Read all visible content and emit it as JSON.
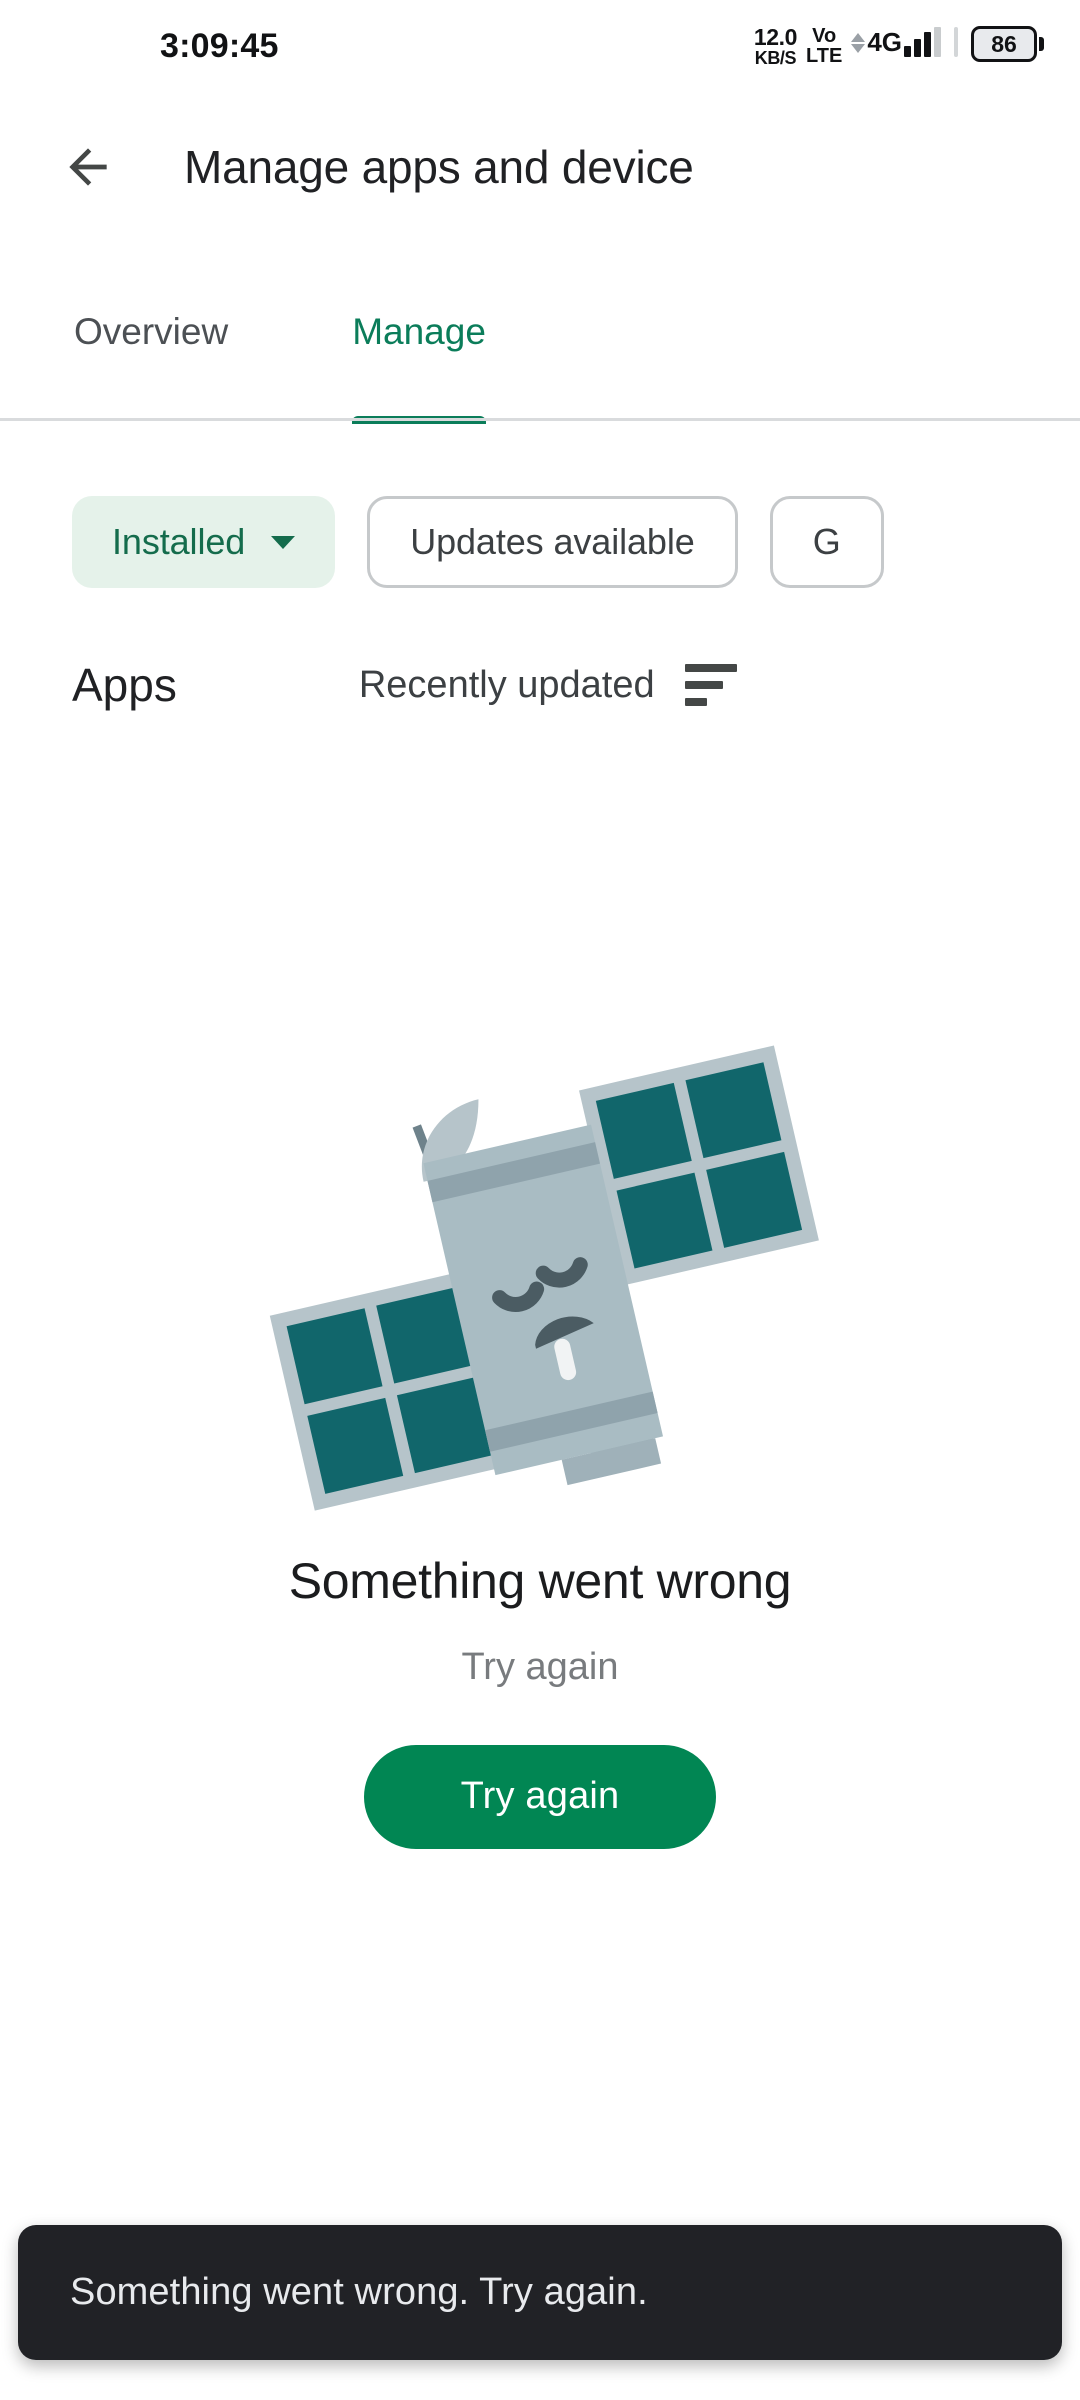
{
  "status_bar": {
    "clock": "3:09:45",
    "net_speed_value": "12.0",
    "net_speed_unit": "KB/S",
    "volte_line1": "Vo",
    "volte_line2": "LTE",
    "network_type": "4G",
    "battery_level": "86"
  },
  "app_bar": {
    "title": "Manage apps and device",
    "back_icon": "arrow-left-icon"
  },
  "tabs": [
    {
      "label": "Overview",
      "active": false
    },
    {
      "label": "Manage",
      "active": true
    }
  ],
  "chips": [
    {
      "label": "Installed",
      "selected": true,
      "has_caret": true
    },
    {
      "label": "Updates available",
      "selected": false,
      "has_caret": false
    },
    {
      "label": "G",
      "selected": false,
      "has_caret": false
    }
  ],
  "apps_section": {
    "heading": "Apps",
    "sort_label": "Recently updated",
    "sort_icon": "sort-lines-icon"
  },
  "error_state": {
    "illustration": "sad-satellite-illustration",
    "title": "Something went wrong",
    "subtitle": "Try again",
    "button_label": "Try again"
  },
  "snackbar": {
    "message": "Something went wrong. Try again."
  },
  "colors": {
    "brand_green": "#018653",
    "tab_green": "#0b7d5a",
    "chip_selected_bg": "#e5f2ea",
    "chip_selected_text": "#146c4c",
    "snackbar_bg": "#212226",
    "satellite_body": "#a9bcc3",
    "satellite_panel": "#11666b",
    "satellite_frame": "#b6c4ca",
    "satellite_face": "#4b5c63"
  }
}
